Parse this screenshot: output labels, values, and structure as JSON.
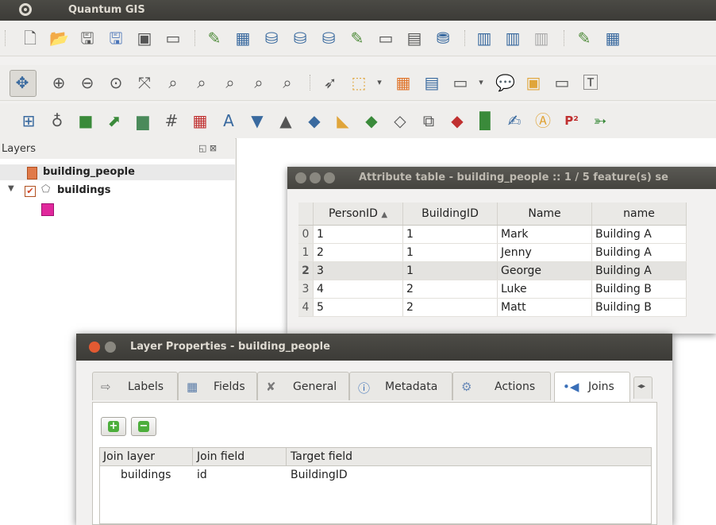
{
  "app": {
    "title": "Quantum GIS"
  },
  "layers_panel": {
    "title": "Layers",
    "layers": [
      {
        "label": "building_people",
        "selected": true
      },
      {
        "label": "buildings",
        "selected": false,
        "checked": true,
        "swatch_color": "#e0289c"
      }
    ]
  },
  "attribute_table": {
    "title": "Attribute table - building_people :: 1 / 5 feature(s) se",
    "columns": [
      "PersonID",
      "BuildingID",
      "Name",
      "name"
    ],
    "sort_indicator": "▲",
    "rows": [
      {
        "index": "0",
        "PersonID": "1",
        "BuildingID": "1",
        "Name": "Mark",
        "name": "Building A"
      },
      {
        "index": "1",
        "PersonID": "2",
        "BuildingID": "1",
        "Name": "Jenny",
        "name": "Building A"
      },
      {
        "index": "2",
        "PersonID": "3",
        "BuildingID": "1",
        "Name": "George",
        "name": "Building A"
      },
      {
        "index": "3",
        "PersonID": "4",
        "BuildingID": "2",
        "Name": "Luke",
        "name": "Building B"
      },
      {
        "index": "4",
        "PersonID": "5",
        "BuildingID": "2",
        "Name": "Matt",
        "name": "Building B"
      }
    ],
    "selected_row": "2"
  },
  "layer_properties": {
    "title": "Layer Properties - building_people",
    "tabs": [
      {
        "label": "Labels",
        "icon": "labels-icon"
      },
      {
        "label": "Fields",
        "icon": "fields-icon"
      },
      {
        "label": "General",
        "icon": "general-icon"
      },
      {
        "label": "Metadata",
        "icon": "info-icon"
      },
      {
        "label": "Actions",
        "icon": "actions-icon"
      },
      {
        "label": "Joins",
        "icon": "joins-icon",
        "active": true
      }
    ],
    "joins": {
      "headers": [
        "Join layer",
        "Join field",
        "Target field"
      ],
      "rows": [
        {
          "join_layer": "buildings",
          "join_field": "id",
          "target_field": "BuildingID"
        }
      ]
    }
  },
  "colors": {
    "accent": "#e25a32",
    "titlebar": "#3c3b37",
    "swatch": "#e0289c"
  }
}
